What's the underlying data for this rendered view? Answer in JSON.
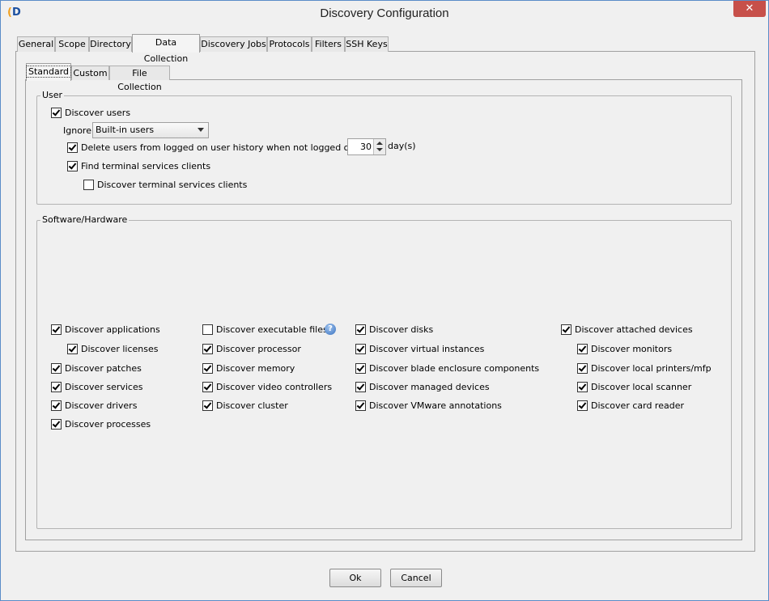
{
  "window": {
    "title": "Discovery Configuration",
    "close_glyph": "✕",
    "app_icon_letters": "D"
  },
  "tabs": [
    "General",
    "Scope",
    "Directory",
    "Data Collection",
    "Discovery Jobs",
    "Protocols",
    "Filters",
    "SSH Keys"
  ],
  "active_tab": "Data Collection",
  "subtabs": [
    "Standard",
    "Custom",
    "File Collection"
  ],
  "active_subtab": "Standard",
  "user_group": {
    "legend": "User",
    "discover_users": "Discover users",
    "ignore_label": "Ignore",
    "ignore_value": "Built-in users",
    "delete_users": "Delete users from logged on user history when not logged on for",
    "days_value": "30",
    "days_unit": "day(s)",
    "find_terminal": "Find terminal services clients",
    "discover_terminal": "Discover terminal services clients"
  },
  "sw_group": {
    "legend": "Software/Hardware",
    "col1": [
      "Discover applications",
      "Discover licenses",
      "Discover patches",
      "Discover services",
      "Discover drivers",
      "Discover processes"
    ],
    "col2": [
      "Discover executable files",
      "Discover processor",
      "Discover memory",
      "Discover video controllers",
      "Discover cluster"
    ],
    "col3": [
      "Discover disks",
      "Discover virtual instances",
      "Discover blade enclosure components",
      "Discover managed devices",
      "Discover VMware annotations"
    ],
    "col4": [
      "Discover attached devices",
      "Discover monitors",
      "Discover local printers/mfp",
      "Discover local scanner",
      "Discover card reader"
    ]
  },
  "icons": {
    "help": "help-icon",
    "help_glyph": "?"
  },
  "buttons": {
    "ok": "Ok",
    "cancel": "Cancel"
  }
}
